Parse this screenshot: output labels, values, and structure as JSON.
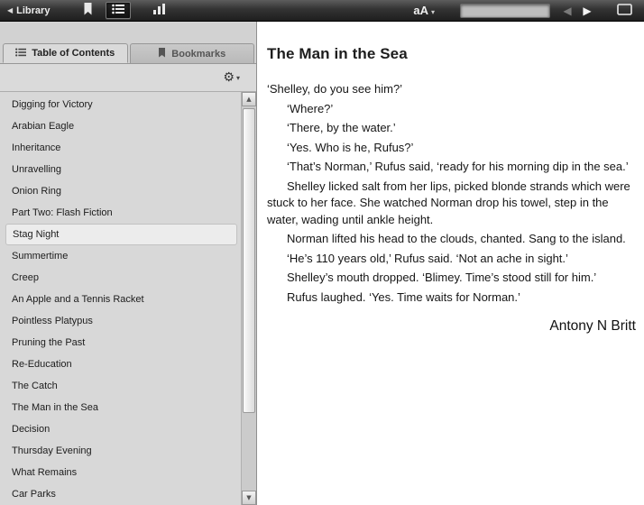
{
  "toolbar": {
    "library_label": "Library",
    "font_size_label": "aA",
    "search_value": ""
  },
  "glyphs": {
    "back": "◀",
    "prev": "◀",
    "next": "▶",
    "caret": "▾",
    "gear": "⚙",
    "scroll_up": "▲",
    "scroll_down": "▼"
  },
  "sidebar": {
    "tabs": [
      {
        "label": "Table of Contents"
      },
      {
        "label": "Bookmarks"
      }
    ],
    "toc_items": [
      "Digging for Victory",
      "Arabian Eagle",
      "Inheritance",
      "Unravelling",
      "Onion Ring",
      "Part Two: Flash Fiction",
      "Stag Night",
      "Summertime",
      "Creep",
      "An Apple and a Tennis Racket",
      "Pointless Platypus",
      "Pruning the Past",
      "Re-Education",
      "The Catch",
      "The Man in the Sea",
      "Decision",
      "Thursday Evening",
      "What Remains",
      "Car Parks"
    ],
    "selected_index": 6
  },
  "content": {
    "title": "The Man in the Sea",
    "paragraphs": [
      {
        "text": "‘Shelley, do you see him?’",
        "indent": false
      },
      {
        "text": "‘Where?’",
        "indent": true
      },
      {
        "text": "‘There, by the water.’",
        "indent": true
      },
      {
        "text": "‘Yes. Who is he, Rufus?’",
        "indent": true
      },
      {
        "text": "‘That’s Norman,’ Rufus said, ‘ready for his morning dip in the sea.’",
        "indent": true
      },
      {
        "text": "Shelley licked salt from her lips, picked blonde strands which were stuck to her face. She watched Norman drop his towel, step in the water, wading until ankle height.",
        "indent": true
      },
      {
        "text": "Norman lifted his head to the clouds, chanted. Sang to the island.",
        "indent": true
      },
      {
        "text": "‘He’s 110 years old,’ Rufus said. ‘Not an ache in sight.’",
        "indent": true
      },
      {
        "text": "Shelley’s mouth dropped. ‘Blimey. Time’s stood still for him.’",
        "indent": true
      },
      {
        "text": "Rufus laughed. ‘Yes. Time waits for Norman.’",
        "indent": true
      }
    ],
    "author": "Antony N Britt"
  }
}
